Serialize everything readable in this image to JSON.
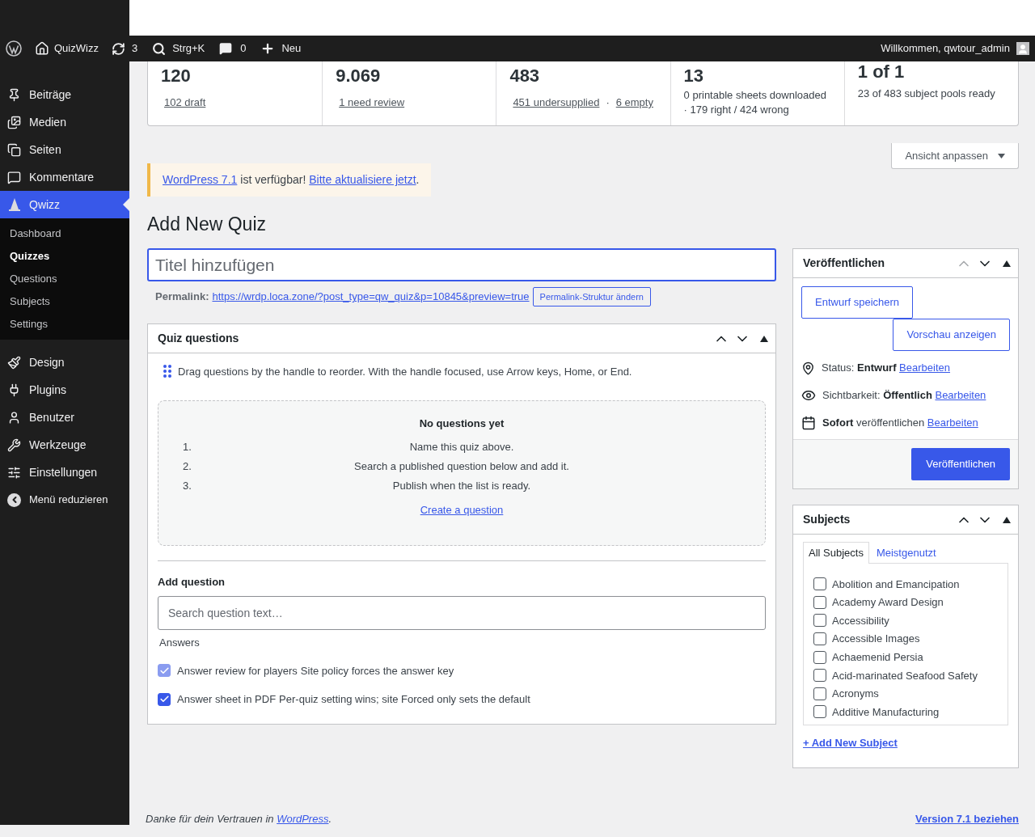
{
  "admin_bar": {
    "site": "QuizWizz",
    "updates": "3",
    "search": "Strg+K",
    "comments": "0",
    "new": "Neu",
    "greeting": "Willkommen, qwtour_admin"
  },
  "sidebar": {
    "items": [
      {
        "label": "Beiträge",
        "selected": false
      },
      {
        "label": "Medien",
        "selected": false
      },
      {
        "label": "Seiten",
        "selected": false
      },
      {
        "label": "Kommentare",
        "selected": false
      },
      {
        "label": "Qwizz",
        "selected": true,
        "children": [
          {
            "label": "Dashboard",
            "selected": false
          },
          {
            "label": "Quizzes",
            "selected": true
          },
          {
            "label": "Questions",
            "selected": false
          },
          {
            "label": "Subjects",
            "selected": false
          },
          {
            "label": "Settings",
            "selected": false
          }
        ]
      },
      {
        "label": "Design",
        "selected": false
      },
      {
        "label": "Plugins",
        "selected": false
      },
      {
        "label": "Benutzer",
        "selected": false
      },
      {
        "label": "Werkzeuge",
        "selected": false
      },
      {
        "label": "Einstellungen",
        "selected": false
      }
    ],
    "collapse": "Menü reduzieren"
  },
  "stats": [
    {
      "kind": "links",
      "value": "120",
      "links": [
        "102 draft"
      ]
    },
    {
      "kind": "links",
      "value": "9.069",
      "links": [
        "1 need review"
      ]
    },
    {
      "kind": "links",
      "value": "483",
      "links": [
        "451 undersupplied",
        "6 empty"
      ],
      "separator": "·"
    },
    {
      "kind": "text",
      "value": "13",
      "text": "0 printable sheets downloaded · 179 right / 424 wrong"
    },
    {
      "kind": "text",
      "value": "1 of 1",
      "text": "23 of 483 subject pools ready"
    }
  ],
  "screen_options": "Ansicht anpassen",
  "notice": {
    "link1": "WordPress 7.1",
    "middle": "ist verfügbar!",
    "link2": "Bitte aktualisiere jetzt",
    "end": "."
  },
  "heading": "Add New Quiz",
  "title_field": {
    "placeholder": "Titel hinzufügen"
  },
  "permalink": {
    "label": "Permalink:",
    "url": "https://wrdp.loca.zone/?post_type=qw_quiz&p=10845&preview=true",
    "button": "Permalink-Struktur ändern"
  },
  "quiz_questions": {
    "title": "Quiz questions",
    "up_disabled": false,
    "hint": "Drag questions by the handle to reorder. With the handle focused, use Arrow keys, Home, or End.",
    "empty": {
      "title": "No questions yet",
      "steps": [
        {
          "number": "1.",
          "text": "Name this quiz above."
        },
        {
          "number": "2.",
          "text": "Search a published question below and add it."
        },
        {
          "number": "3.",
          "text": "Publish when the list is ready."
        }
      ],
      "link": "Create a question"
    },
    "add_title": "Add question",
    "search": {
      "placeholder": "Search question text…"
    },
    "answers_label": "Answers",
    "options": [
      {
        "label": "Answer review for players",
        "hint": "Site policy forces the answer key",
        "checked": true,
        "disabled": true
      },
      {
        "label": "Answer sheet in PDF",
        "hint": "Per-quiz setting wins; site Forced only sets the default",
        "checked": true,
        "disabled": false
      }
    ]
  },
  "publish": {
    "title": "Veröffentlichen",
    "up_disabled": true,
    "save_draft": "Entwurf speichern",
    "preview": "Vorschau anzeigen",
    "status": {
      "label": "Status:",
      "value": "Entwurf",
      "edit": "Bearbeiten"
    },
    "visibility": {
      "label": "Sichtbarkeit:",
      "value": "Öffentlich",
      "edit": "Bearbeiten"
    },
    "schedule": {
      "value": "Sofort",
      "label": "veröffentlichen",
      "edit": "Bearbeiten"
    },
    "button": "Veröffentlichen"
  },
  "subjects": {
    "title": "Subjects",
    "up_disabled": false,
    "tabs": [
      {
        "label": "All Subjects",
        "selected": true
      },
      {
        "label": "Meistgenutzt",
        "selected": false
      }
    ],
    "items": [
      {
        "label": "Abolition and Emancipation",
        "checked": false
      },
      {
        "label": "Academy Award Design",
        "checked": false
      },
      {
        "label": "Accessibility",
        "checked": false
      },
      {
        "label": "Accessible Images",
        "checked": false
      },
      {
        "label": "Achaemenid Persia",
        "checked": false
      },
      {
        "label": "Acid-marinated Seafood Safety",
        "checked": false
      },
      {
        "label": "Acronyms",
        "checked": false
      },
      {
        "label": "Additive Manufacturing",
        "checked": false
      }
    ],
    "add": "+ Add New Subject"
  },
  "footer": {
    "thanks": "Danke für dein Vertrauen in",
    "link": "WordPress",
    "end": ".",
    "version": "Version 7.1 beziehen"
  }
}
